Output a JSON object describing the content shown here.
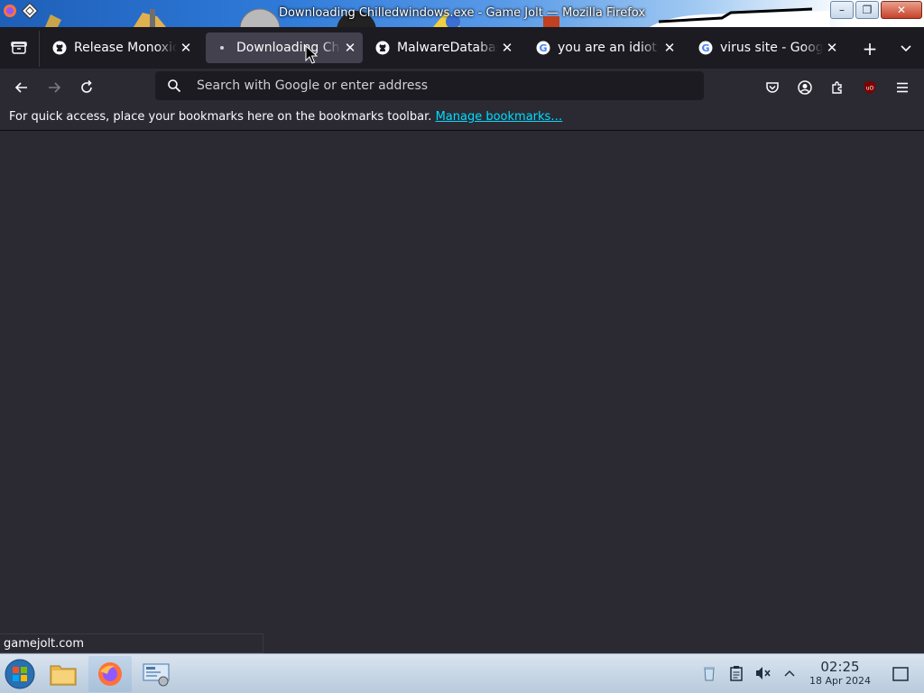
{
  "window": {
    "title": "Downloading Chilledwindows.exe - Game Jolt — Mozilla Firefox"
  },
  "tabs": [
    {
      "label": "Release Monoxide",
      "favicon": "github-icon",
      "active": false
    },
    {
      "label": "Downloading Chilledwindows.exe - Game Jolt",
      "favicon": "loading-dot-icon",
      "active": true
    },
    {
      "label": "MalwareDatabase",
      "favicon": "github-icon",
      "active": false
    },
    {
      "label": "you are an idiot - Google Search",
      "favicon": "google-icon",
      "active": false
    },
    {
      "label": "virus site - Google Search",
      "favicon": "google-icon",
      "active": false
    }
  ],
  "urlbar": {
    "placeholder": "Search with Google or enter address",
    "value": ""
  },
  "bookmarks": {
    "message": "For quick access, place your bookmarks here on the bookmarks toolbar.",
    "link": "Manage bookmarks…"
  },
  "status": {
    "hover_url": "gamejolt.com"
  },
  "taskbar": {
    "time": "02:25",
    "date": "18 Apr 2024"
  },
  "colors": {
    "accent_link": "#00ddff",
    "tab_active": "#42414d",
    "toolbar": "#2b2a33",
    "tabstrip": "#1c1b22"
  }
}
